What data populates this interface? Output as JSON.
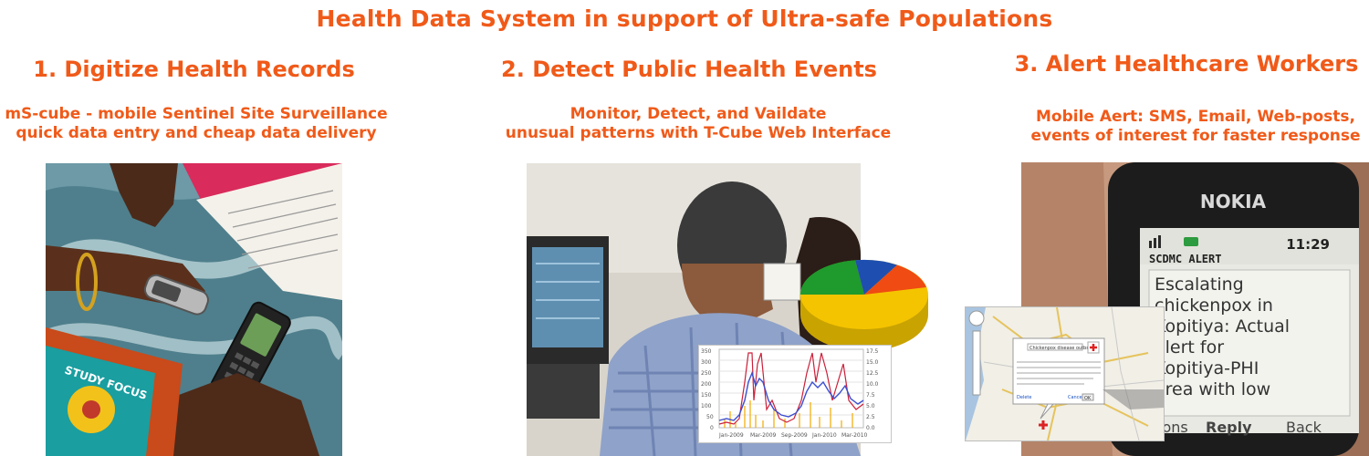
{
  "title": "Health Data System in support of Ultra-safe Populations",
  "sections": [
    {
      "heading": "1. Digitize Health Records",
      "subtitle_line1": "mS-cube - mobile Sentinel Site Surveillance",
      "subtitle_line2": "quick data entry and cheap data delivery",
      "photo_icon": "hands-with-mobile-phones-photo",
      "book_text": "STUDY FOCUS"
    },
    {
      "heading": "2. Detect Public Health Events",
      "subtitle_line1": "Monitor, Detect, and Vaildate",
      "subtitle_line2": "unusual patterns with T-Cube Web Interface",
      "photo_icon": "man-at-computer-photo",
      "chart_x_ticks": [
        "Jan-2009",
        "Mar-2009",
        "Sep-2009",
        "Jan-2010",
        "Mar-2010"
      ],
      "chart_y_ticks": [
        "350",
        "300",
        "250",
        "200",
        "150",
        "100",
        "50",
        "0"
      ],
      "chart_y2_ticks": [
        "17.5",
        "15.0",
        "12.5",
        "10.0",
        "7.5",
        "5.0",
        "2.5",
        "0.0"
      ],
      "pie_colors": [
        "#f5c400",
        "#1f9a2c",
        "#1e4fb0",
        "#ef4b12"
      ]
    },
    {
      "heading": "3. Alert Healthcare Workers",
      "subtitle_line1": "Mobile Aert: SMS, Email, Web-posts,",
      "subtitle_line2": "events of interest for faster response",
      "photo_icon": "nokia-phone-sms-photo",
      "phone_brand": "NOKIA",
      "phone_time": "11:29",
      "sms_header": "SCDMC ALERT",
      "sms_lines": [
        "Escalating",
        "chickenpox in",
        "Kopitiya: Actual",
        "alert for",
        "Kopitiya-PHI",
        "area with low"
      ],
      "softkey_options": "ions",
      "softkey_reply": "Reply",
      "softkey_back": "Back",
      "map_popup_title": "Chickenpox disease outbreak",
      "map_popup_close": "Cancel",
      "map_popup_ok": "OK",
      "map_popup_delete": "Delete"
    }
  ],
  "colors": {
    "accent": "#f05a19"
  }
}
